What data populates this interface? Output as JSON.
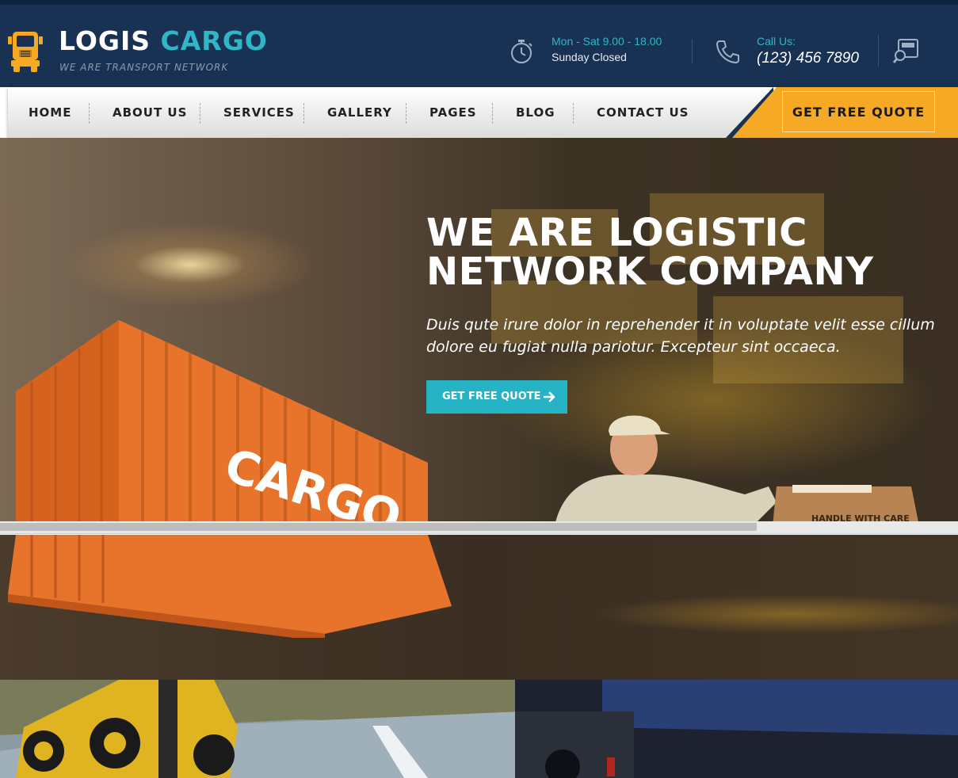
{
  "header": {
    "logo": {
      "title_part1": "LOGIS",
      "title_part2": "CARGO",
      "tagline": "WE ARE TRANSPORT NETWORK",
      "icon": "truck-icon"
    },
    "hours": {
      "icon": "stopwatch-icon",
      "line1": "Mon - Sat 9.00 - 18.00",
      "line2": "Sunday Closed"
    },
    "call": {
      "icon": "phone-icon",
      "label": "Call Us:",
      "number": "(123) 456 7890"
    },
    "tracking_icon": "track-search-icon"
  },
  "nav": {
    "items": [
      {
        "label": "HOME"
      },
      {
        "label": "ABOUT US"
      },
      {
        "label": "SERVICES"
      },
      {
        "label": "GALLERY"
      },
      {
        "label": "PAGES"
      },
      {
        "label": "BLOG"
      },
      {
        "label": "CONTACT US"
      }
    ],
    "quote_button": "GET FREE QUOTE"
  },
  "hero": {
    "title_line1": "WE ARE LOGISTIC",
    "title_line2": "NETWORK COMPANY",
    "subtitle_line1": "Duis qute irure dolor in reprehender it in voluptate velit esse cillum",
    "subtitle_line2": "dolore eu fugiat nulla pariotur. Excepteur sint occaeca.",
    "cta_label": "GET FREE QUOTE",
    "cta_icon": "arrow-right-icon",
    "container_text": "CARGO",
    "box_text": "HANDLE WITH CARE"
  },
  "slider": {
    "progress": 0.79
  },
  "colors": {
    "header_bg": "#193152",
    "accent_teal": "#27b3c6",
    "accent_orange": "#f6a924",
    "container_orange": "#e8742b"
  }
}
